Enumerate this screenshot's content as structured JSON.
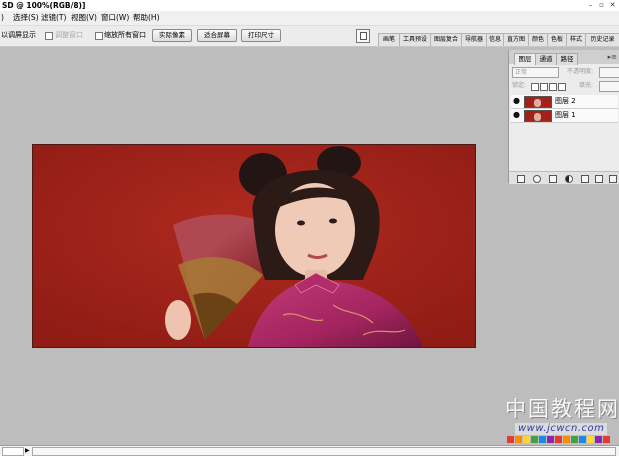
{
  "window": {
    "title": "SD @ 100%(RGB/8)]",
    "minimize": "–",
    "restore": "▫",
    "close": "✕"
  },
  "menu": {
    "items": [
      "选择(S)",
      "滤镜(T)",
      "视图(V)",
      "窗口(W)",
      "帮助(H)"
    ],
    "left_fragment": ")"
  },
  "options": {
    "fit_text": "以调屏显示",
    "resize_windows": "调整窗口",
    "zoom_all_windows": "缩放所有窗口",
    "actual_pixels": "实际像素",
    "fit_screen": "适合屏幕",
    "print_size": "打印尺寸"
  },
  "palette_well": {
    "tabs": [
      "画笔",
      "工具预设",
      "图层复合",
      "导航器",
      "信息",
      "直方图",
      "颜色",
      "色板",
      "样式",
      "历史记录"
    ]
  },
  "layers_panel": {
    "tabs": [
      "图层",
      "通道",
      "路径"
    ],
    "menu_glyph": "▸≡",
    "blend_mode": "正常",
    "opacity_label": "不透明度:",
    "lock_label": "锁定:",
    "fill_label": "填充:",
    "layers": [
      {
        "name": "图层 2",
        "visible": true
      },
      {
        "name": "图层 1",
        "visible": true
      }
    ]
  },
  "colors": {
    "canvas_bg": "#a32119",
    "workspace_bg": "#bdbdbd"
  },
  "watermark": {
    "chinese": "中国教程网",
    "url": "www.jcwcn.com"
  }
}
